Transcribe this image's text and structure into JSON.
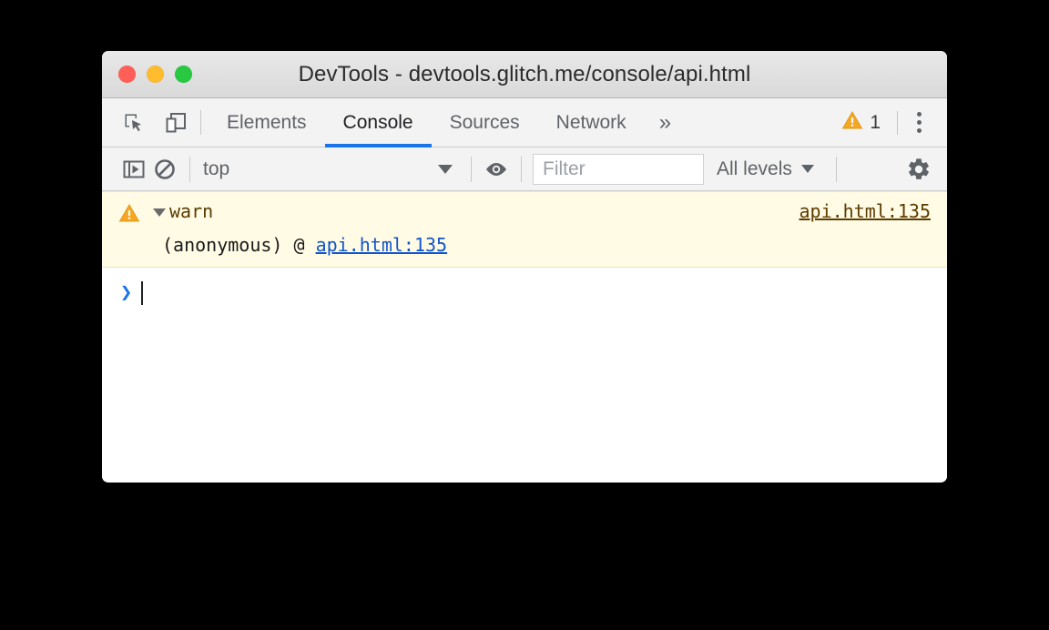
{
  "window": {
    "title": "DevTools - devtools.glitch.me/console/api.html",
    "controls": [
      {
        "name": "close",
        "color": "#ff5f57"
      },
      {
        "name": "minimize",
        "color": "#febc2e"
      },
      {
        "name": "maximize",
        "color": "#28c840"
      }
    ]
  },
  "tabbar": {
    "icons": [
      {
        "name": "inspect-element-icon",
        "title": "Inspect element"
      },
      {
        "name": "device-toolbar-icon",
        "title": "Toggle device toolbar"
      }
    ],
    "tabs": [
      {
        "label": "Elements",
        "active": false
      },
      {
        "label": "Console",
        "active": true
      },
      {
        "label": "Sources",
        "active": false
      },
      {
        "label": "Network",
        "active": false
      }
    ],
    "more_label": "»",
    "warning_count": "1",
    "menu_label": "Customize and control DevTools"
  },
  "console_toolbar": {
    "sidebar_toggle": "console-sidebar-icon",
    "clear_console": "clear-console-icon",
    "context": {
      "value": "top",
      "caret": "▼"
    },
    "eye_icon": "live-expression-eye-icon",
    "filter": {
      "value": "",
      "placeholder": "Filter"
    },
    "levels": {
      "label": "All levels",
      "caret": "▼"
    },
    "settings_icon": "settings-gear-icon"
  },
  "console": {
    "messages": [
      {
        "type": "warning",
        "disclosure": "▼",
        "text": "warn",
        "source": "api.html:135",
        "stack": {
          "frame": "(anonymous) @ ",
          "link": "api.html:135"
        }
      }
    ],
    "prompt": {
      "arrow": "❯",
      "value": ""
    }
  },
  "colors": {
    "accent": "#1a73e8",
    "warning_bg": "#fffbe5",
    "warning_border": "#f2e8b6",
    "warning_text": "#5c3c00",
    "warning_icon": "#f5a623",
    "link": "#1155cc"
  }
}
